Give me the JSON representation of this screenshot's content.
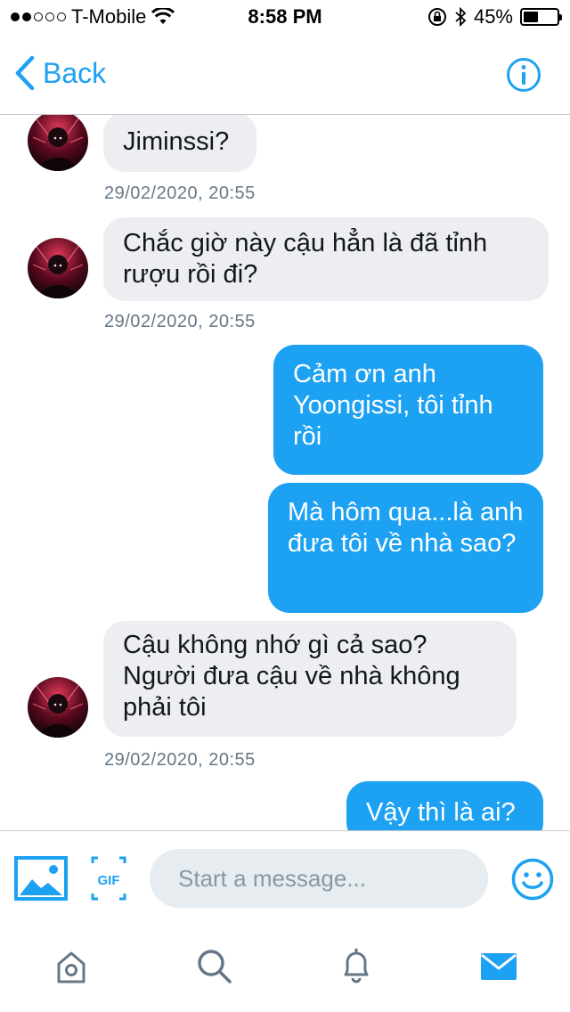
{
  "status_bar": {
    "carrier": "T-Mobile",
    "time": "8:58 PM",
    "battery": "45%",
    "battery_level": 0.45
  },
  "nav": {
    "back_label": "Back",
    "info_icon": "info-icon"
  },
  "messages": [
    {
      "side": "in",
      "text": "Jiminssi?"
    },
    {
      "stamp": "29/02/2020, 20:55"
    },
    {
      "side": "in",
      "text": "Chắc giờ này cậu hẳn là đã tỉnh rượu rồi đi?"
    },
    {
      "stamp": "29/02/2020, 20:55"
    },
    {
      "side": "out",
      "text": "Cảm ơn anh Yoongissi, tôi tỉnh rồi"
    },
    {
      "side": "out",
      "text": "Mà hôm qua...là anh đưa tôi về nhà sao?"
    },
    {
      "side": "in",
      "text": "Cậu không nhớ gì cả sao? Người đưa cậu về nhà không phải tôi"
    },
    {
      "stamp": "29/02/2020, 20:55"
    },
    {
      "side": "out",
      "text": "Vậy thì là ai?"
    }
  ],
  "composer": {
    "placeholder": "Start a message...",
    "gif_label": "GIF",
    "media_icon": "image-icon",
    "emoji_icon": "emoji-icon"
  },
  "tabs": [
    "home-icon",
    "search-icon",
    "notifications-icon",
    "messages-icon"
  ],
  "colors": {
    "accent": "#1da1f2",
    "incoming_bubble": "#eceef1",
    "timestamp": "#657786"
  }
}
